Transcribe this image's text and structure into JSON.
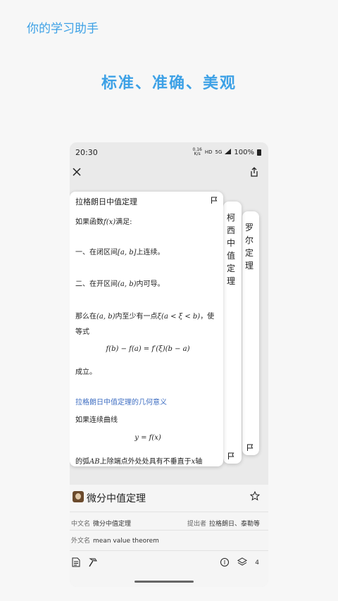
{
  "app_title": "你的学习助手",
  "headline": "标准、准确、美观",
  "status_bar": {
    "time": "20:30",
    "speed_top": "0.16",
    "speed_unit": "K/s",
    "hd": "HD",
    "net": "5G",
    "battery": "100%"
  },
  "cards": [
    {
      "title": "拉格朗日中值定理",
      "lines": {
        "l1": "如果函数",
        "l1_math": "f(x)",
        "l1_end": "满足:",
        "l2": "一、在闭区间",
        "l2_math": "[a, b]",
        "l2_end": "上连续。",
        "l3": "二、在开区间",
        "l3_math": "(a, b)",
        "l3_end": "内可导。",
        "l4": "那么在",
        "l4_math1": "(a, b)",
        "l4_mid": "内至少有一点",
        "l4_math2": "ξ(a < ξ < b)",
        "l4_end": "，使",
        "l5": "等式",
        "eq1": "f(b) − f(a) = f′(ξ)(b − a)",
        "l6": "成立。",
        "link": "拉格朗日中值定理的几何意义",
        "l7": "如果连续曲线",
        "eq2": "y = f(x)",
        "l8": "的弧",
        "l8_math": "AB",
        "l8_mid": "上除端点外处处具有不垂直于",
        "l8_math2": "x",
        "l8_end": "轴"
      }
    },
    {
      "title": "柯西中值定理"
    },
    {
      "title": "罗尔定理"
    }
  ],
  "subject": {
    "name": "微分中值定理",
    "chinese_label": "中文名",
    "chinese_value": "微分中值定理",
    "proposer_label": "提出者",
    "proposer_value": "拉格朗日、泰勒等",
    "foreign_label": "外文名",
    "foreign_value": "mean value theorem",
    "layer_count": "4"
  },
  "icons": [
    "close-icon",
    "share-icon",
    "flag-icon",
    "star-icon",
    "document-icon",
    "hammer-icon",
    "circle-icon",
    "layers-icon"
  ],
  "accent_color": "#3da1e6"
}
